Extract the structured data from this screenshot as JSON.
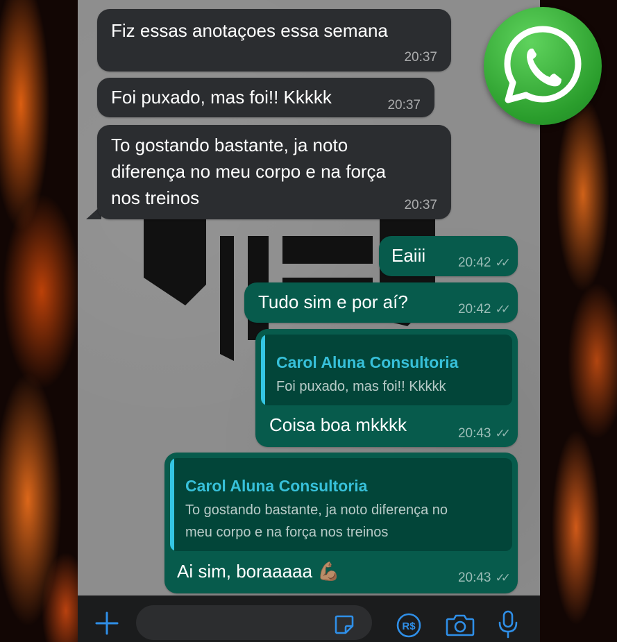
{
  "messages": [
    {
      "text": "Fiz essas anotaçoes essa semana",
      "time": "20:37"
    },
    {
      "text": "Foi puxado, mas foi!! Kkkkk",
      "time": "20:37"
    },
    {
      "lines": [
        "To gostando bastante, ja noto",
        "diferença no meu corpo e na força",
        "nos treinos"
      ],
      "time": "20:37"
    },
    {
      "text": "Eaiii",
      "time": "20:42",
      "status": "read-check-icon"
    },
    {
      "text": "Tudo sim e por aí?",
      "time": "20:42",
      "status": "read-check-icon"
    },
    {
      "reply_author": "Carol Aluna Consultoria",
      "reply_text": "Foi puxado, mas foi!! Kkkkk",
      "text": "Coisa boa mkkkk",
      "time": "20:43",
      "status": "read-check-icon"
    },
    {
      "reply_author": "Carol Aluna Consultoria",
      "reply_lines": [
        "To gostando bastante, ja noto diferença no",
        "meu corpo e na força nos treinos"
      ],
      "text": "Ai sim, boraaaaa 💪🏽",
      "time": "20:43",
      "status": "read-check-icon"
    }
  ],
  "input_bar": {
    "icons": [
      "plus-icon",
      "sticker-icon",
      "payment-icon",
      "camera-icon",
      "microphone-icon"
    ],
    "payment_label": "R$"
  },
  "colors": {
    "incoming_bubble": "#2b2d30",
    "outgoing_bubble": "#075b4c",
    "quote_bg": "#024539",
    "quote_accent": "#34c6e3",
    "icon_blue": "#2f8fe8",
    "whatsapp_green": "#2a9d2c"
  },
  "badge": {
    "icon": "whatsapp-logo-icon"
  }
}
